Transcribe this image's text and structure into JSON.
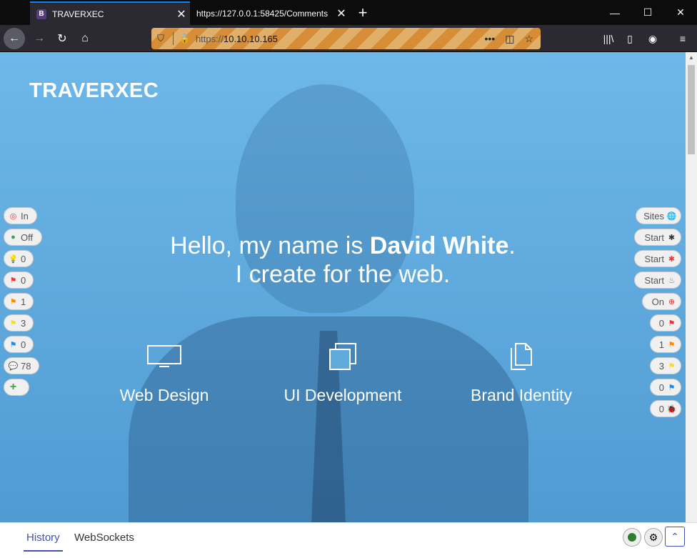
{
  "tabs": [
    {
      "favicon": "B",
      "title": "TRAVERXEC",
      "active": true
    },
    {
      "title": "https://127.0.0.1:58425/Comments",
      "active": false
    }
  ],
  "url": {
    "protocol": "https://",
    "host": "10.10.10.165"
  },
  "page": {
    "brand": "TRAVERXEC",
    "hero_prefix": "Hello, my name is ",
    "hero_name": "David White",
    "hero_suffix": ".",
    "hero_line2": "I create for the web.",
    "services": [
      {
        "icon": "monitor-icon",
        "label": "Web Design"
      },
      {
        "icon": "windows-icon",
        "label": "UI Development"
      },
      {
        "icon": "documents-icon",
        "label": "Brand Identity"
      }
    ]
  },
  "left_pills": [
    {
      "icon": "target-icon",
      "color": "#e53935",
      "value": "In"
    },
    {
      "icon": "green-circle-icon",
      "color": "#43a047",
      "value": "Off"
    },
    {
      "icon": "lightbulb-icon",
      "color": "#fbc02d",
      "value": "0"
    },
    {
      "icon": "red-flag-icon",
      "color": "#e53935",
      "value": "0"
    },
    {
      "icon": "orange-flag-icon",
      "color": "#fb8c00",
      "value": "1"
    },
    {
      "icon": "yellow-flag-icon",
      "color": "#fdd835",
      "value": "3"
    },
    {
      "icon": "blue-flag-icon",
      "color": "#1e88e5",
      "value": "0"
    },
    {
      "icon": "comment-icon",
      "color": "#9e9e9e",
      "value": "78"
    },
    {
      "icon": "plus-icon",
      "color": "#43a047",
      "value": ""
    }
  ],
  "right_pills": [
    {
      "icon": "globe-icon",
      "value": "Sites"
    },
    {
      "icon": "spider-icon",
      "value": "Start"
    },
    {
      "icon": "red-spider-icon",
      "value": "Start"
    },
    {
      "icon": "flame-icon",
      "value": "Start"
    },
    {
      "icon": "lifebuoy-icon",
      "value": "On"
    },
    {
      "icon": "red-flag-icon",
      "value": "0"
    },
    {
      "icon": "orange-flag-icon",
      "value": "1"
    },
    {
      "icon": "yellow-flag-icon",
      "value": "3"
    },
    {
      "icon": "blue-flag-icon",
      "value": "0"
    },
    {
      "icon": "bug-icon",
      "value": "0"
    }
  ],
  "hud": {
    "tab_history": "History",
    "tab_websockets": "WebSockets"
  }
}
